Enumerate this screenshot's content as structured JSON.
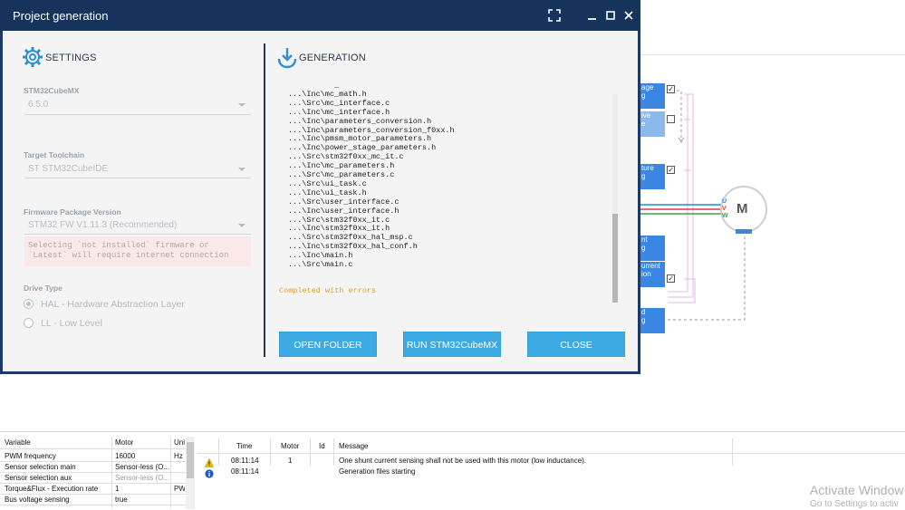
{
  "dialog": {
    "title": "Project generation",
    "settings": {
      "heading": "SETTINGS",
      "cubemx_label": "STM32CubeMX",
      "cubemx_value": "6.5.0",
      "toolchain_label": "Target Toolchain",
      "toolchain_value": "ST STM32CubeIDE",
      "firmware_label": "Firmware Package Version",
      "firmware_value": "STM32 FW V1.11.3 (Recommended)",
      "warning_line1": "Selecting `not installed` firmware or",
      "warning_line2": "`Latest` will require internet connection",
      "drive_label": "Drive Type",
      "drive_options": [
        "HAL - Hardware Abstraction Layer",
        "LL - Low Level"
      ],
      "drive_selected": "HAL - Hardware Abstraction Layer"
    },
    "generation": {
      "heading": "GENERATION",
      "log_lines": [
        "...\\Src\\mc_math.c",
        "...\\Inc\\mc_math.h",
        "...\\Src\\mc_interface.c",
        "...\\Inc\\mc_interface.h",
        "...\\Inc\\parameters_conversion.h",
        "...\\Inc\\parameters_conversion_f0xx.h",
        "...\\Inc\\pmsm_motor_parameters.h",
        "...\\Inc\\power_stage_parameters.h",
        "...\\Src\\stm32f0xx_mc_it.c",
        "...\\Inc\\mc_parameters.h",
        "...\\Src\\mc_parameters.c",
        "...\\Src\\ui_task.c",
        "...\\Inc\\ui_task.h",
        "...\\Src\\user_interface.c",
        "...\\Inc\\user_interface.h",
        "...\\Src\\stm32f0xx_it.c",
        "...\\Inc\\stm32f0xx_it.h",
        "...\\Src\\stm32f0xx_hal_msp.c",
        "...\\Inc\\stm32f0xx_hal_conf.h",
        "...\\Inc\\main.h",
        "...\\Src\\main.c"
      ],
      "status": "Completed with errors"
    },
    "buttons": {
      "open_folder": "OPEN FOLDER",
      "run_cubemx": "RUN STM32CubeMX",
      "close": "CLOSE"
    }
  },
  "background": {
    "blocks": [
      {
        "line1": "age",
        "line2": "g"
      },
      {
        "line1": "ive",
        "line2": "e"
      },
      {
        "line1": "ture",
        "line2": "g"
      },
      {
        "line1": "nt",
        "line2": "g"
      },
      {
        "line1": "urrent",
        "line2": "ion"
      },
      {
        "line1": "d",
        "line2": "g"
      }
    ],
    "motor_label": "M",
    "phase_labels": [
      "U",
      "V",
      "W"
    ],
    "phase_colors": [
      "#1e88e5",
      "#e53935",
      "#43a047"
    ],
    "accent_color": "#3a86e0"
  },
  "variables": {
    "headers": [
      "Variable",
      "Motor",
      "Uni"
    ],
    "rows": [
      [
        "PWM frequency",
        "16000",
        "Hz"
      ],
      [
        "Sensor selection main",
        "Sensor-less (O...",
        ""
      ],
      [
        "Sensor selection aux",
        "Sensor-less (O...",
        ""
      ],
      [
        "Torque&Flux - Execution rate",
        "1",
        "PW"
      ],
      [
        "Bus voltage sensing",
        "true",
        ""
      ]
    ]
  },
  "messages": {
    "headers": [
      "Time",
      "Motor",
      "Id",
      "Message"
    ],
    "rows": [
      {
        "icon": "warning-icon",
        "time": "08:11:14",
        "motor": "1",
        "id": "",
        "message": "One shunt current sensing shall not be used with this motor (low inductance)."
      },
      {
        "icon": "info-icon",
        "time": "08:11:14",
        "motor": "",
        "id": "",
        "message": "Generation files starting"
      }
    ]
  },
  "watermark": {
    "title": "Activate Window",
    "subtitle": "Go to Settings to activ"
  }
}
